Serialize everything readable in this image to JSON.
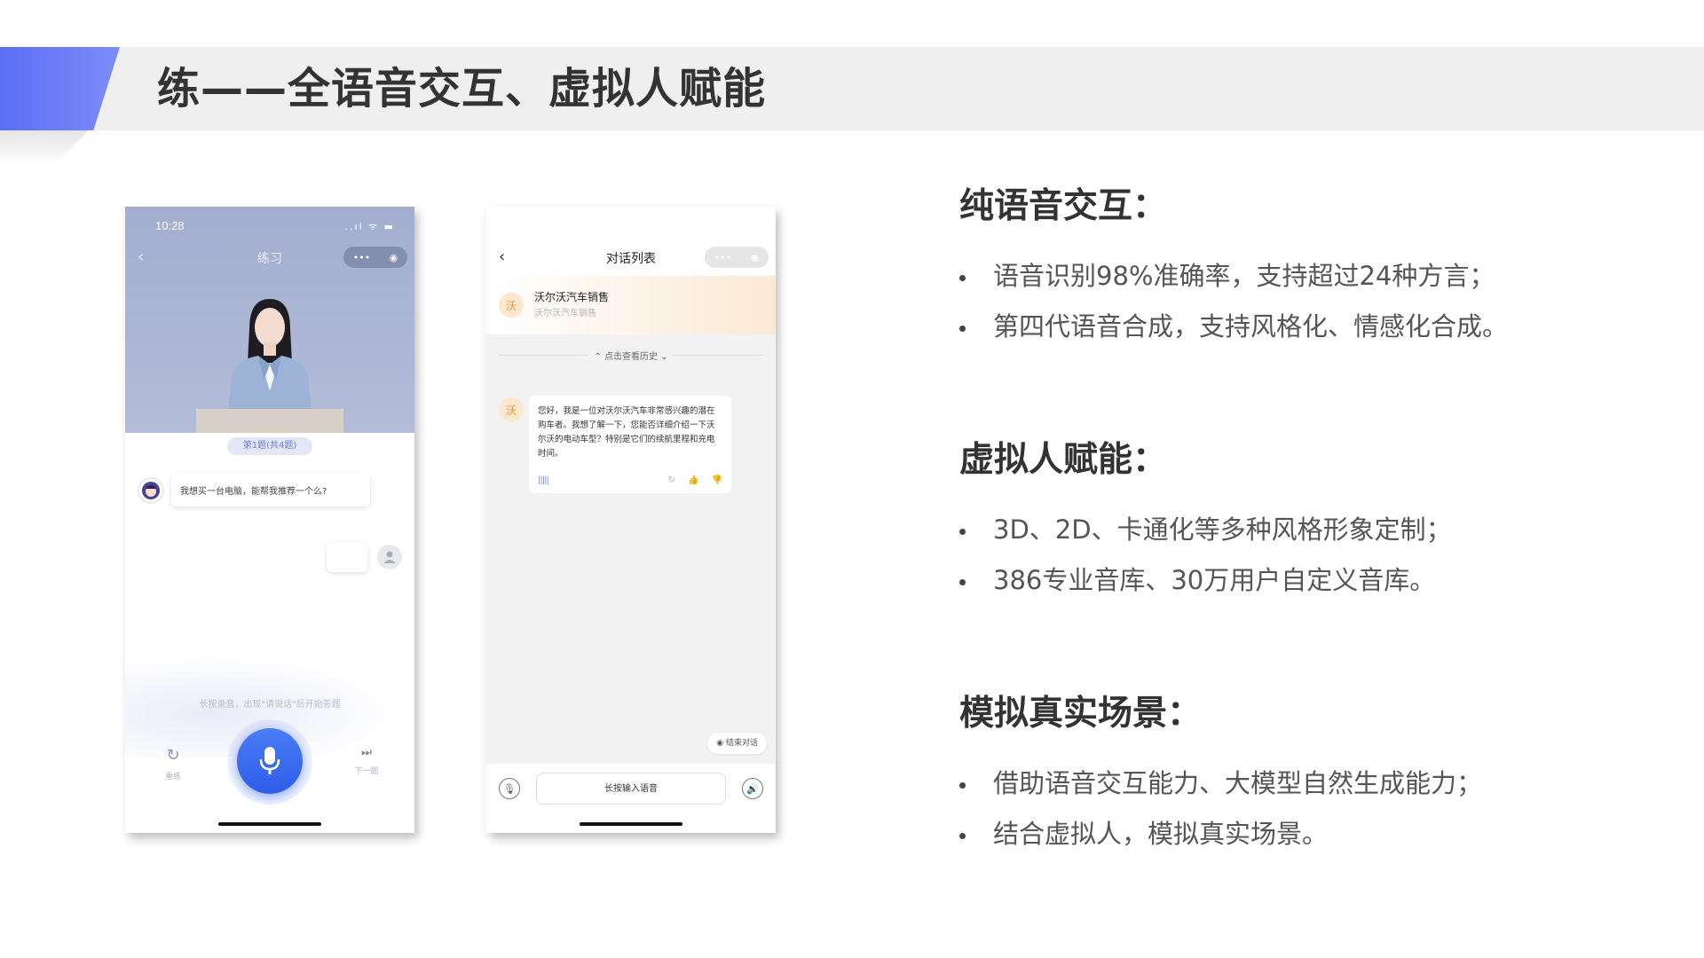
{
  "page_title": "练——全语音交互、虚拟人赋能",
  "phone1": {
    "status_time": "10:28",
    "status_icons": "..ıl ᯤ ▬",
    "back_icon": "‹",
    "title": "练习",
    "capsule_menu": "•••",
    "capsule_close": "◉",
    "question_badge": "第1题(共4题)",
    "bot_message": "我想买一台电脑，能帮我推荐一个么?",
    "hint": "长按录音，出现\"请说话\"后开始答题",
    "left_button": {
      "icon": "↻",
      "label": "重练"
    },
    "right_button": {
      "icon": "⏭",
      "label": "下一题"
    }
  },
  "phone2": {
    "back_icon": "‹",
    "title": "对话列表",
    "capsule_menu": "•••",
    "capsule_close": "◉",
    "contact": {
      "badge": "沃",
      "name": "沃尔沃汽车销售",
      "sub": "沃尔沃汽车销售"
    },
    "history_label": "⌃ 点击查看历史 ⌄",
    "message": {
      "badge": "沃",
      "text": "您好，我是一位对沃尔沃汽车非常感兴趣的潜在购车者。我想了解一下，您能否详细介绍一下沃尔沃的电动车型？特别是它们的续航里程和充电时间。",
      "voice_icon": "|||||",
      "action_icons": [
        "↻",
        "👍",
        "👎"
      ]
    },
    "end_chat": "◉ 结束对话",
    "footer": {
      "left_icon": "🎙",
      "input_label": "长按输入语音",
      "right_icon": "🔊"
    }
  },
  "sections": [
    {
      "heading": "纯语音交互：",
      "bullets": [
        "语音识别98%准确率，支持超过24种方言；",
        "第四代语音合成，支持风格化、情感化合成。"
      ]
    },
    {
      "heading": "虚拟人赋能：",
      "bullets": [
        "3D、2D、卡通化等多种风格形象定制；",
        "386专业音库、30万用户自定义音库。"
      ]
    },
    {
      "heading": "模拟真实场景：",
      "bullets": [
        "借助语音交互能力、大模型自然生成能力；",
        "结合虚拟人，模拟真实场景。"
      ]
    }
  ],
  "colors": {
    "accent": "#5b6ff5",
    "mic": "#2d5de8",
    "brand_badge": "#e49a45"
  }
}
